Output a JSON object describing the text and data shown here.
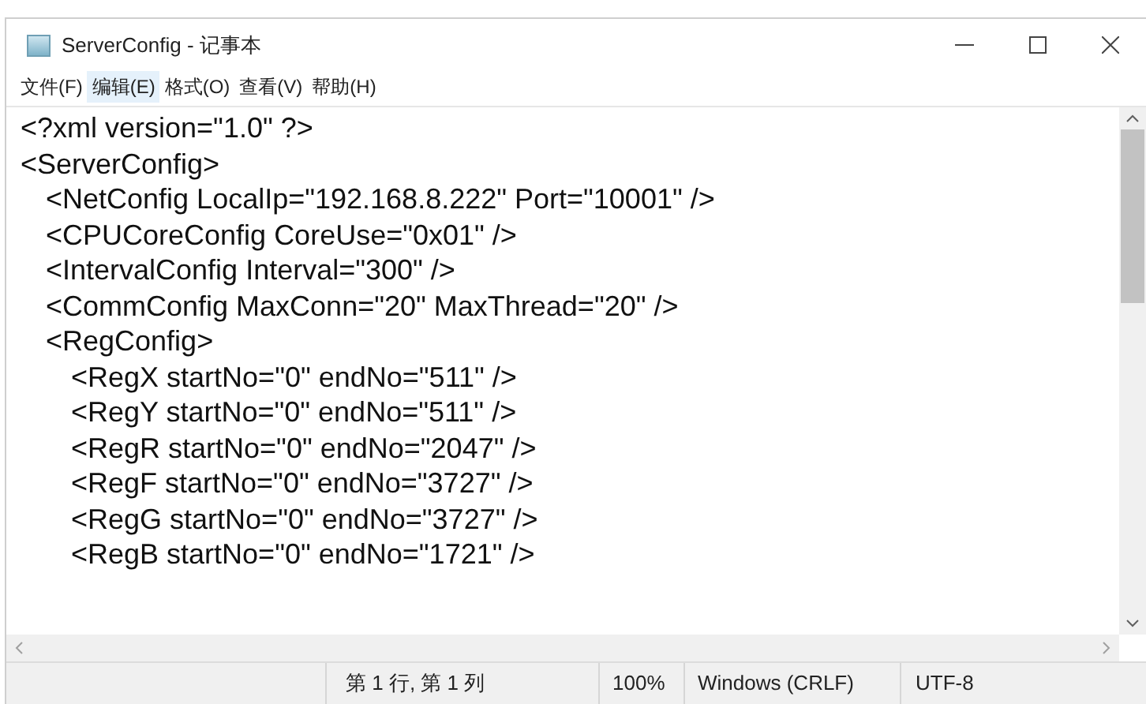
{
  "window": {
    "title": "ServerConfig - 记事本"
  },
  "menu": [
    {
      "label": "文件(F)",
      "selected": false
    },
    {
      "label": "编辑(E)",
      "selected": true
    },
    {
      "label": "格式(O)",
      "selected": false
    },
    {
      "label": "查看(V)",
      "selected": false
    },
    {
      "label": "帮助(H)",
      "selected": false
    }
  ],
  "editor": {
    "lines": [
      {
        "text": "<?xml version=\"1.0\" ?>"
      },
      {
        "text": "<ServerConfig>",
        "children": [
          {
            "text": "<NetConfig LocalIp=\"192.168.8.222\" Port=\"10001\" />"
          },
          {
            "text": "<CPUCoreConfig CoreUse=\"0x01\" />"
          },
          {
            "text": "<IntervalConfig Interval=\"300\" />"
          },
          {
            "text": "<CommConfig MaxConn=\"20\" MaxThread=\"20\" />"
          },
          {
            "text": "<RegConfig>",
            "children": [
              {
                "text": "<RegX startNo=\"0\" endNo=\"511\" />"
              },
              {
                "text": "<RegY startNo=\"0\" endNo=\"511\" />"
              },
              {
                "text": "<RegR startNo=\"0\" endNo=\"2047\" />"
              },
              {
                "text": "<RegF startNo=\"0\" endNo=\"3727\" />"
              },
              {
                "text": "<RegG startNo=\"0\" endNo=\"3727\" />"
              },
              {
                "text": "<RegB startNo=\"0\" endNo=\"1721\" />"
              }
            ]
          }
        ]
      }
    ]
  },
  "status_bar": {
    "position": "第 1 行, 第 1 列",
    "zoom": "100%",
    "line_ending": "Windows (CRLF)",
    "encoding": "UTF-8"
  }
}
